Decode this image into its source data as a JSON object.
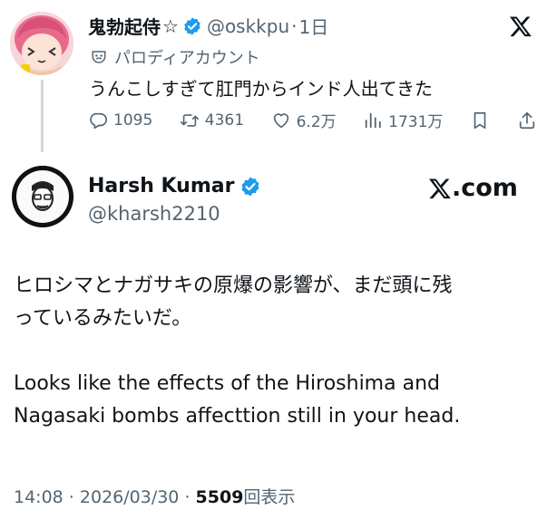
{
  "tweet1": {
    "display_name": "鬼勃起侍",
    "name_suffix": "☆",
    "handle": "@oskkpu",
    "separator": "·",
    "time_ago": "1日",
    "parody_label": "パロディアカウント",
    "text": "うんこしすぎて肛門からインド人出てきた",
    "actions": {
      "replies": "1095",
      "retweets": "4361",
      "likes": "6.2万",
      "views": "1731万"
    }
  },
  "tweet2": {
    "display_name": "Harsh Kumar",
    "handle": "@kharsh2210",
    "brand": ".com",
    "body_lines_jp": [
      "ヒロシマとナガサキの原爆の影響が、まだ頭に残",
      "っているみたいだ。"
    ],
    "body_lines_en": [
      "Looks like the effects of the Hiroshima and",
      "Nagasaki bombs affecttion still in your head."
    ],
    "meta": {
      "time": "14:08",
      "sep1": " · ",
      "date": "2026/03/30",
      "sep2": " · ",
      "views_count": "5509",
      "views_label": "回表示"
    }
  },
  "colors": {
    "text_primary": "#0f1419",
    "text_secondary": "#536471",
    "verified_blue": "#1d9bf0",
    "thread_line": "#cfd9de"
  },
  "icons": {
    "reply": "speech-bubble-icon",
    "retweet": "retweet-icon",
    "like": "heart-icon",
    "views": "bar-chart-icon",
    "bookmark": "bookmark-icon",
    "share": "share-icon",
    "x_logo": "x-logo-icon",
    "verified": "verified-badge-icon",
    "parody": "mask-icon"
  }
}
